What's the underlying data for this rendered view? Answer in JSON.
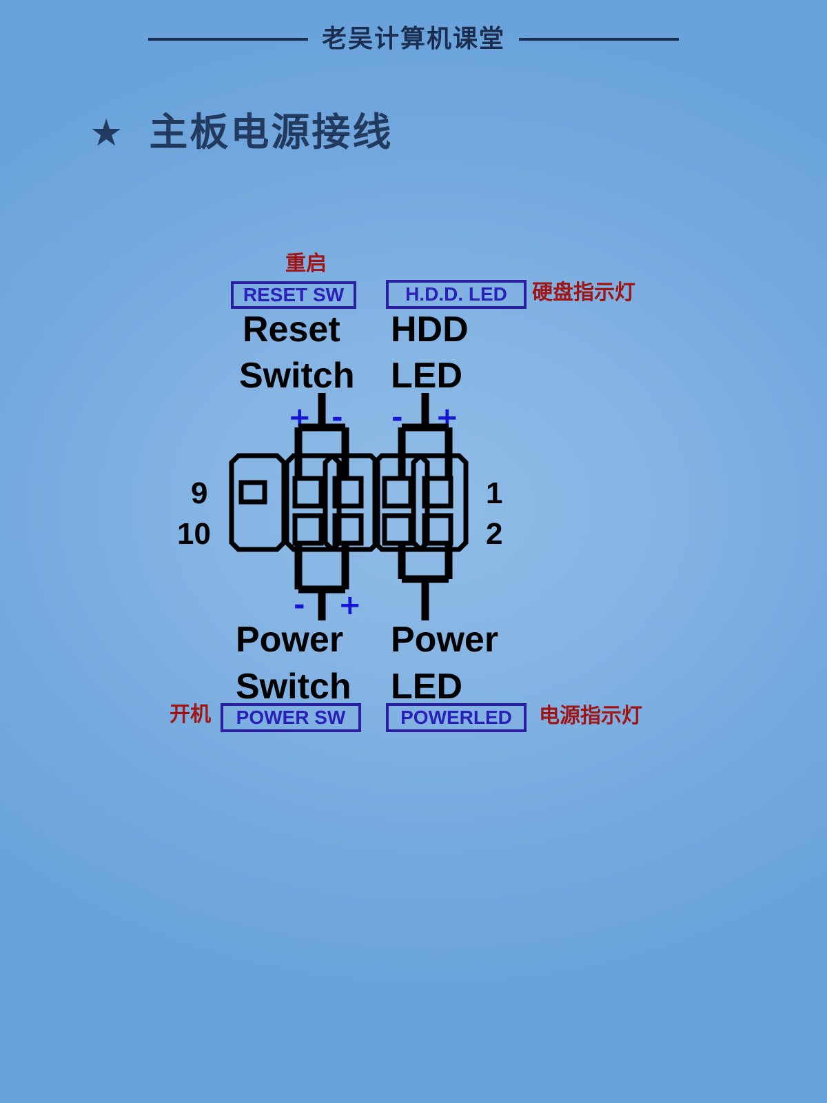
{
  "header": {
    "brand": "老吴计算机课堂",
    "rule_left": "horizontal-rule",
    "rule_right": "horizontal-rule"
  },
  "title": {
    "bullet": "★",
    "text": "主板电源接线"
  },
  "diagram": {
    "caption_top_left_red": "重启",
    "caption_top_right_red": "硬盘指示灯",
    "caption_bottom_left_red": "开机",
    "caption_bottom_right_red": "电源指示灯",
    "connector_tags": {
      "reset_sw": "RESET SW",
      "hdd_led": "H.D.D. LED",
      "power_sw": "POWER SW",
      "power_led": "POWERLED"
    },
    "connector_names": {
      "reset_line1": "Reset",
      "reset_line2": "Switch",
      "hdd_line1": "HDD",
      "hdd_line2": "LED",
      "powersw_line1": "Power",
      "powersw_line2": "Switch",
      "powerled_line1": "Power",
      "powerled_line2": "LED"
    },
    "polarity": {
      "reset_left": "+",
      "reset_right": "-",
      "hdd_left": "-",
      "hdd_right": "+",
      "powersw_left": "-",
      "powersw_right": "+"
    },
    "pin_numbers": {
      "top_left": "9",
      "bottom_left": "10",
      "top_right": "1",
      "bottom_right": "2"
    }
  },
  "colors": {
    "background_top": "#6fa6dd",
    "background_mid": "#8bb9e7",
    "ink_dark_blue": "#223a5e",
    "tag_border": "#2a1f9e",
    "tag_text": "#2a1fb8",
    "red_label": "#a01414",
    "sign_blue": "#1414d2",
    "wire_black": "#000000"
  }
}
